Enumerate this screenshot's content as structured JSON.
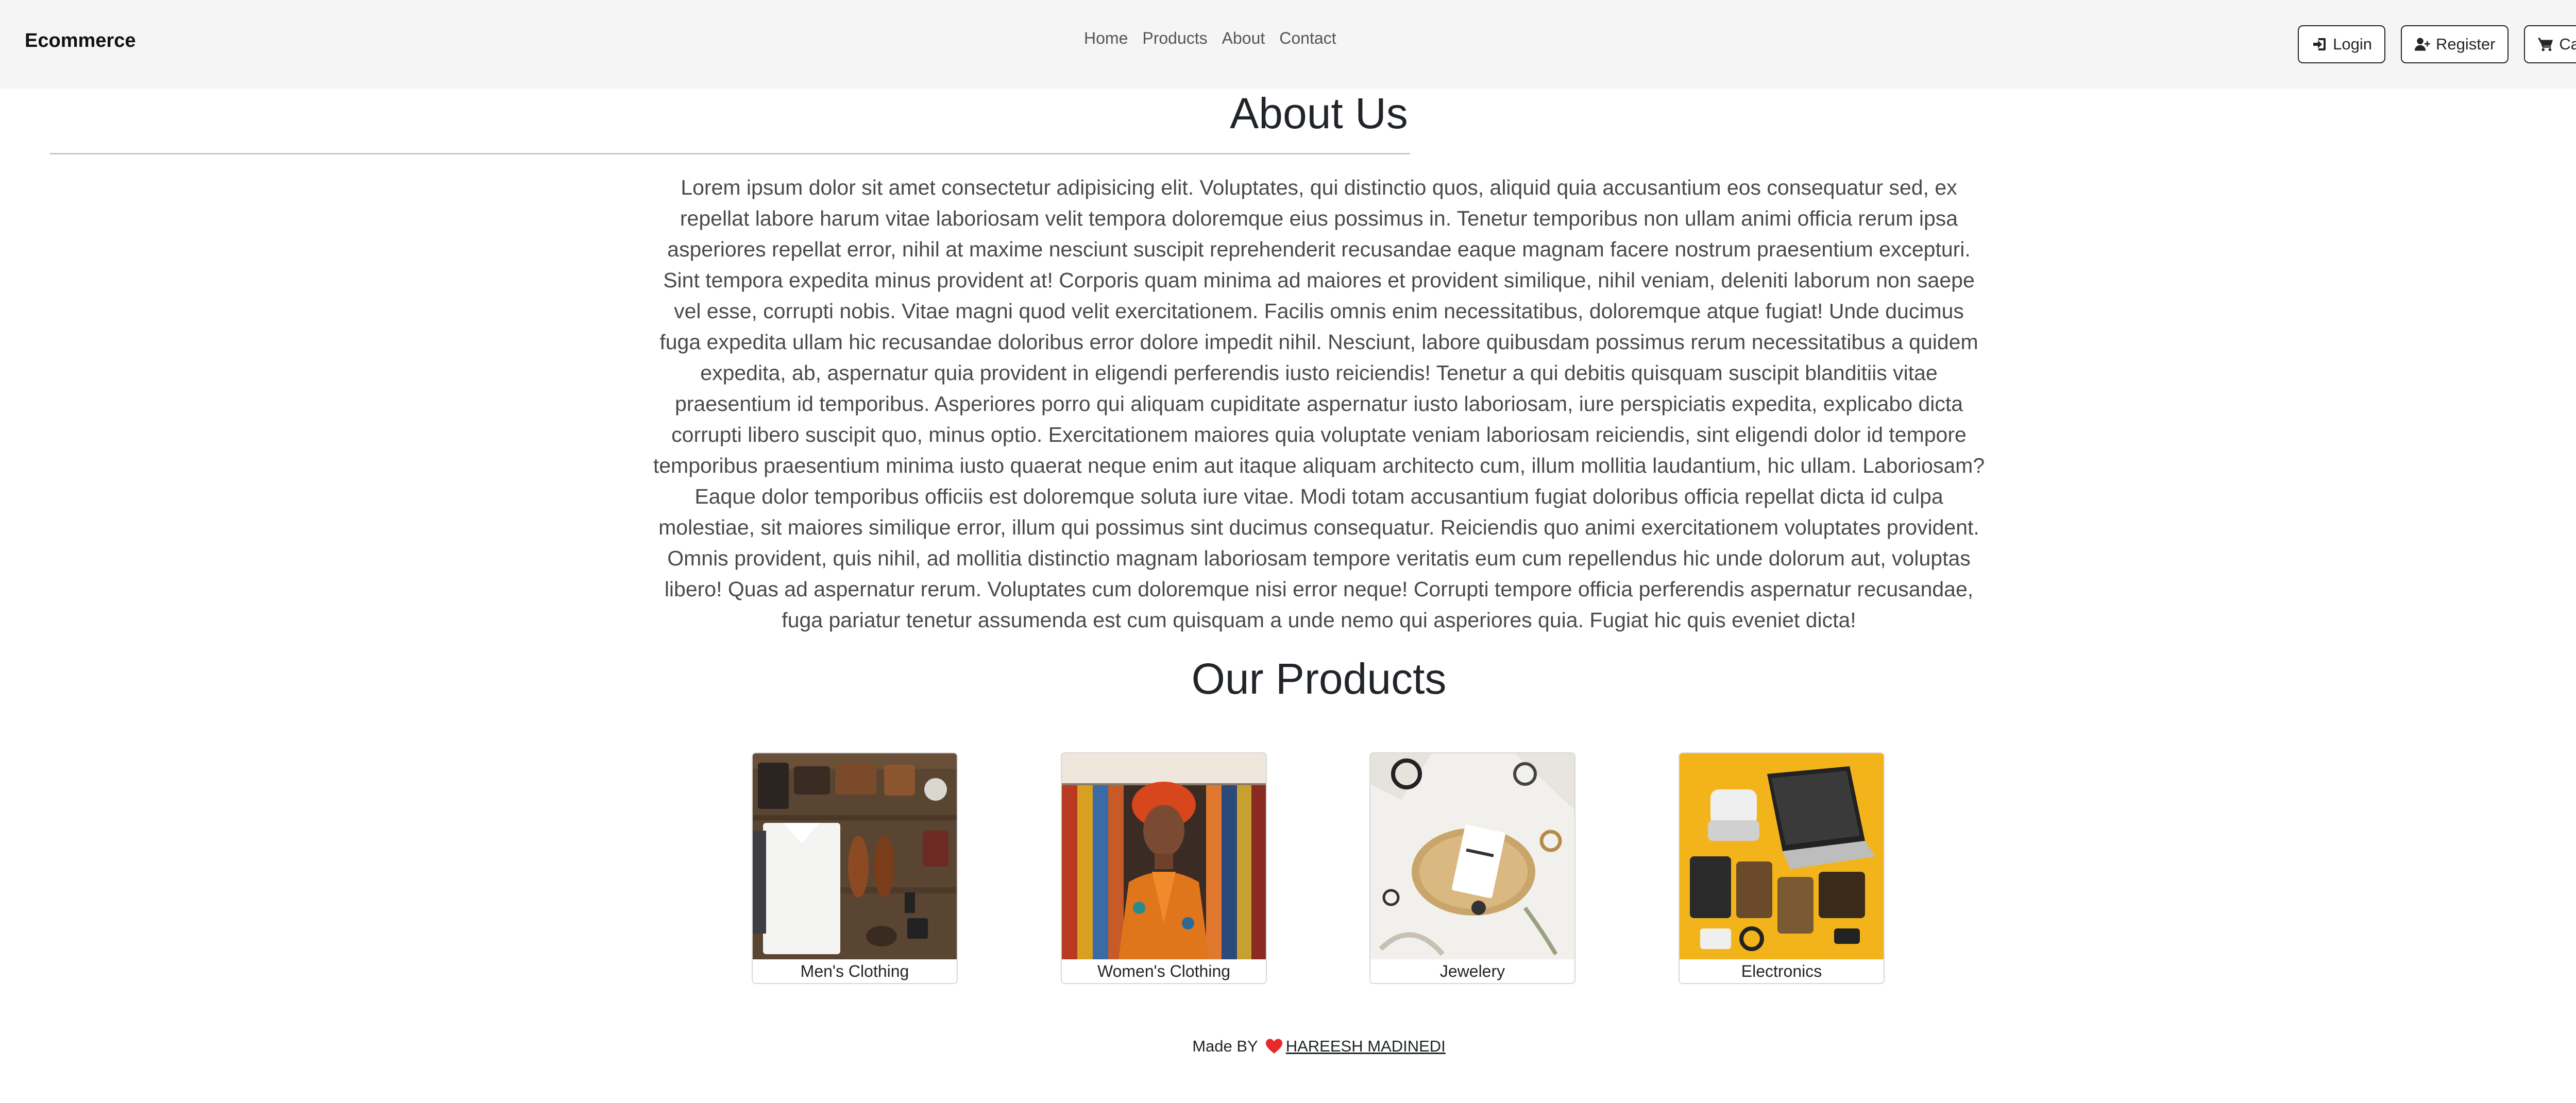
{
  "navbar": {
    "brand": "Ecommerce",
    "links": [
      {
        "label": "Home"
      },
      {
        "label": "Products"
      },
      {
        "label": "About"
      },
      {
        "label": "Contact"
      }
    ],
    "buttons": {
      "login": "Login",
      "register": "Register",
      "cart": "Cart"
    }
  },
  "about": {
    "title": "About Us",
    "text": "Lorem ipsum dolor sit amet consectetur adipisicing elit. Voluptates, qui distinctio quos, aliquid quia accusantium eos consequatur sed, ex repellat labore harum vitae laboriosam velit tempora doloremque eius possimus in. Tenetur temporibus non ullam animi officia rerum ipsa asperiores repellat error, nihil at maxime nesciunt suscipit reprehenderit recusandae eaque magnam facere nostrum praesentium excepturi. Sint tempora expedita minus provident at! Corporis quam minima ad maiores et provident similique, nihil veniam, deleniti laborum non saepe vel esse, corrupti nobis. Vitae magni quod velit exercitationem. Facilis omnis enim necessitatibus, doloremque atque fugiat! Unde ducimus fuga expedita ullam hic recusandae doloribus error dolore impedit nihil. Nesciunt, labore quibusdam possimus rerum necessitatibus a quidem expedita, ab, aspernatur quia provident in eligendi perferendis iusto reiciendis! Tenetur a qui debitis quisquam suscipit blanditiis vitae praesentium id temporibus. Asperiores porro qui aliquam cupiditate aspernatur iusto laboriosam, iure perspiciatis expedita, explicabo dicta corrupti libero suscipit quo, minus optio. Exercitationem maiores quia voluptate veniam laboriosam reiciendis, sint eligendi dolor id tempore temporibus praesentium minima iusto quaerat neque enim aut itaque aliquam architecto cum, illum mollitia laudantium, hic ullam. Laboriosam? Eaque dolor temporibus officiis est doloremque soluta iure vitae. Modi totam accusantium fugiat doloribus officia repellat dicta id culpa molestiae, sit maiores similique error, illum qui possimus sint ducimus consequatur. Reiciendis quo animi exercitationem voluptates provident. Omnis provident, quis nihil, ad mollitia distinctio magnam laboriosam tempore veritatis eum cum repellendus hic unde dolorum aut, voluptas libero! Quas ad aspernatur rerum. Voluptates cum doloremque nisi error neque! Corrupti tempore officia perferendis aspernatur recusandae, fuga pariatur tenetur assumenda est cum quisquam a unde nemo qui asperiores quia. Fugiat hic quis eveniet dicta!"
  },
  "products": {
    "title": "Our Products",
    "items": [
      {
        "name": "Men's Clothing",
        "image_icon": "mens-clothing-flatlay-image"
      },
      {
        "name": "Women's Clothing",
        "image_icon": "womens-clothing-portrait-image"
      },
      {
        "name": "Jewelery",
        "image_icon": "jewelery-flatlay-image"
      },
      {
        "name": "Electronics",
        "image_icon": "electronics-flatlay-image"
      }
    ]
  },
  "footer": {
    "prefix": "Made BY",
    "heart_icon": "heart-icon",
    "author": "HAREESH MADINEDI"
  },
  "colors": {
    "navbar_bg": "#f5f5f5",
    "heart": "#e8282b",
    "electronics_bg": "#f3b41b"
  }
}
